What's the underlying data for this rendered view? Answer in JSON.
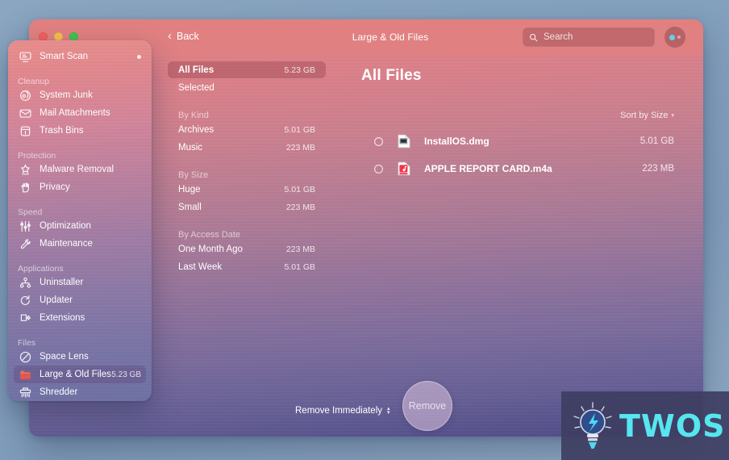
{
  "window": {
    "title": "Large & Old Files",
    "back_label": "Back",
    "traffic_lights": [
      "close-red",
      "minimize-yellow",
      "zoom-green"
    ]
  },
  "search": {
    "placeholder": "Search",
    "value": "",
    "icon": "search-icon"
  },
  "account": {
    "icon": "account-avatar-icon"
  },
  "sidebar": {
    "sections": [
      {
        "label": "",
        "items": [
          {
            "icon": "smart-scan-icon",
            "label": "Smart Scan",
            "size": "",
            "badge": "dot",
            "active": false
          }
        ]
      },
      {
        "label": "Cleanup",
        "items": [
          {
            "icon": "system-junk-icon",
            "label": "System Junk",
            "size": "",
            "badge": "",
            "active": false
          },
          {
            "icon": "mail-attachments-icon",
            "label": "Mail Attachments",
            "size": "",
            "badge": "",
            "active": false
          },
          {
            "icon": "trash-bins-icon",
            "label": "Trash Bins",
            "size": "",
            "badge": "",
            "active": false
          }
        ]
      },
      {
        "label": "Protection",
        "items": [
          {
            "icon": "malware-removal-icon",
            "label": "Malware Removal",
            "size": "",
            "badge": "",
            "active": false
          },
          {
            "icon": "privacy-icon",
            "label": "Privacy",
            "size": "",
            "badge": "",
            "active": false
          }
        ]
      },
      {
        "label": "Speed",
        "items": [
          {
            "icon": "optimization-icon",
            "label": "Optimization",
            "size": "",
            "badge": "",
            "active": false
          },
          {
            "icon": "maintenance-icon",
            "label": "Maintenance",
            "size": "",
            "badge": "",
            "active": false
          }
        ]
      },
      {
        "label": "Applications",
        "items": [
          {
            "icon": "uninstaller-icon",
            "label": "Uninstaller",
            "size": "",
            "badge": "",
            "active": false
          },
          {
            "icon": "updater-icon",
            "label": "Updater",
            "size": "",
            "badge": "",
            "active": false
          },
          {
            "icon": "extensions-icon",
            "label": "Extensions",
            "size": "",
            "badge": "",
            "active": false
          }
        ]
      },
      {
        "label": "Files",
        "items": [
          {
            "icon": "space-lens-icon",
            "label": "Space Lens",
            "size": "",
            "badge": "",
            "active": false
          },
          {
            "icon": "large-old-files-icon",
            "label": "Large & Old Files",
            "size": "5.23 GB",
            "badge": "",
            "active": true
          },
          {
            "icon": "shredder-icon",
            "label": "Shredder",
            "size": "",
            "badge": "",
            "active": false
          }
        ]
      }
    ]
  },
  "categories": [
    {
      "type": "item",
      "label": "All Files",
      "size": "5.23 GB",
      "selected": true
    },
    {
      "type": "item",
      "label": "Selected",
      "size": "",
      "selected": false
    },
    {
      "type": "heading",
      "label": "By Kind"
    },
    {
      "type": "item",
      "label": "Archives",
      "size": "5.01 GB",
      "selected": false
    },
    {
      "type": "item",
      "label": "Music",
      "size": "223 MB",
      "selected": false
    },
    {
      "type": "heading",
      "label": "By Size"
    },
    {
      "type": "item",
      "label": "Huge",
      "size": "5.01 GB",
      "selected": false
    },
    {
      "type": "item",
      "label": "Small",
      "size": "223 MB",
      "selected": false
    },
    {
      "type": "heading",
      "label": "By Access Date"
    },
    {
      "type": "item",
      "label": "One Month Ago",
      "size": "223 MB",
      "selected": false
    },
    {
      "type": "item",
      "label": "Last Week",
      "size": "5.01 GB",
      "selected": false
    }
  ],
  "content": {
    "title": "All Files",
    "sort_label": "Sort by Size",
    "sort_caret": "▾",
    "files": [
      {
        "name": "InstallOS.dmg",
        "size": "5.01 GB",
        "icon": "dmg-file-icon",
        "checked": false
      },
      {
        "name": "APPLE REPORT CARD.m4a",
        "size": "223 MB",
        "icon": "audio-file-icon",
        "checked": false
      }
    ]
  },
  "bottom": {
    "mode_label": "Remove Immediately",
    "mode_caret": "⌃⌄",
    "action_label": "Remove"
  },
  "watermark": {
    "text": "TWOS",
    "icon": "lightbulb-icon",
    "color": "#56e6f0"
  },
  "colors": {
    "desktop": "#839fbc",
    "window_top": "#e2807f",
    "window_bottom": "#4e4a86",
    "accent_cyan": "#5fd3e8"
  }
}
